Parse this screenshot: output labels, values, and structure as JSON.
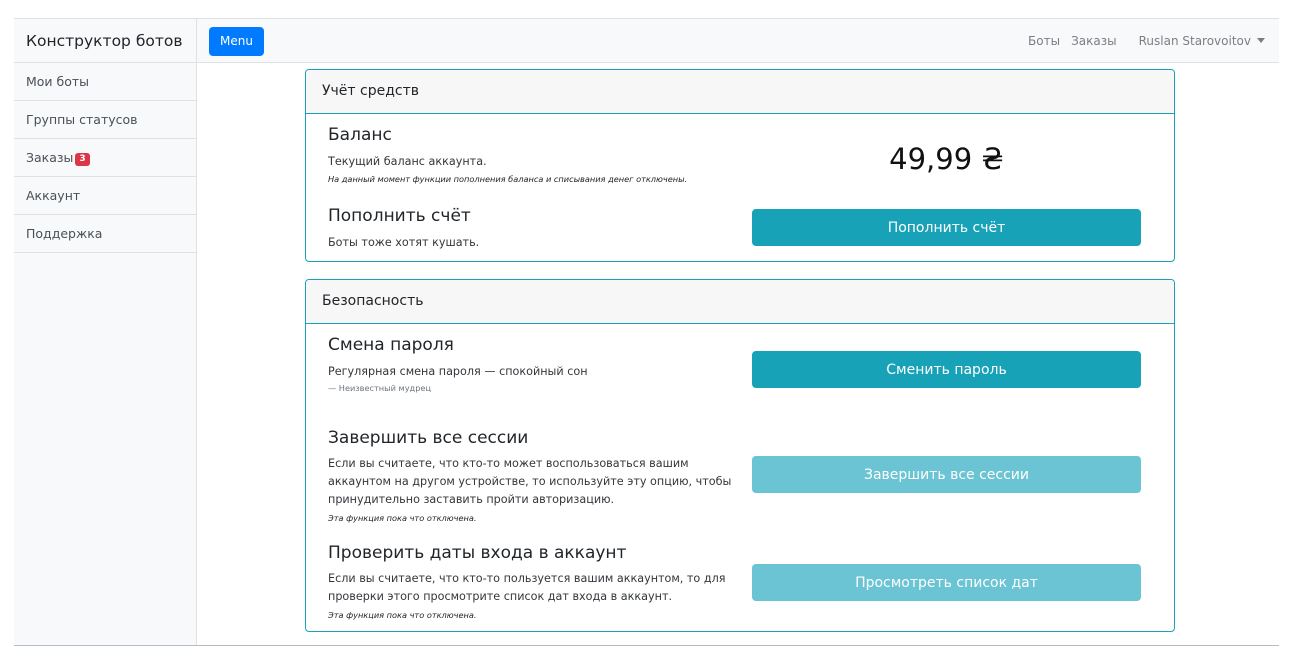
{
  "sidebar": {
    "heading": "Конструктор ботов",
    "items": [
      {
        "label": "Мои боты"
      },
      {
        "label": "Группы статусов"
      },
      {
        "label": "Заказы",
        "badge": "3"
      },
      {
        "label": "Аккаунт"
      },
      {
        "label": "Поддержка"
      }
    ]
  },
  "topnav": {
    "menu_label": "Menu",
    "links": [
      "Боты",
      "Заказы"
    ],
    "user": "Ruslan Starovoitov",
    "user_icon": "caret-down-icon"
  },
  "finance": {
    "header": "Учёт средств",
    "balance_title": "Баланс",
    "balance_desc": "Текущий баланс аккаунта.",
    "balance_note": "На данный момент функции пополнения баланса и списывания денег отключены.",
    "balance_value": "49,99 ₴",
    "topup_title": "Пополнить счёт",
    "topup_desc": "Боты тоже хотят кушать.",
    "topup_button": "Пополнить счёт"
  },
  "security": {
    "header": "Безопасность",
    "password_title": "Смена пароля",
    "password_desc": "Регулярная смена пароля — спокойный сон",
    "password_cite": "— Неизвестный мудрец",
    "password_button": "Сменить пароль",
    "sessions_title": "Завершить все сессии",
    "sessions_desc": "Если вы считаете, что кто-то может воспользоваться вашим аккаунтом на другом устройстве, то используйте эту опцию, чтобы принудительно заставить пройти авторизацию.",
    "sessions_note": "Эта функция пока что отключена.",
    "sessions_button": "Завершить все сессии",
    "dates_title": "Проверить даты входа в аккаунт",
    "dates_desc": "Если вы считаете, что кто-то пользуется вашим аккаунтом, то для проверки этого просмотрите список дат входа в аккаунт.",
    "dates_note": "Эта функция пока что отключена.",
    "dates_button": "Просмотреть список дат"
  },
  "colors": {
    "primary": "#007bff",
    "info": "#17a2b8",
    "info_disabled": "#6bc4d3",
    "danger": "#dc3545"
  }
}
